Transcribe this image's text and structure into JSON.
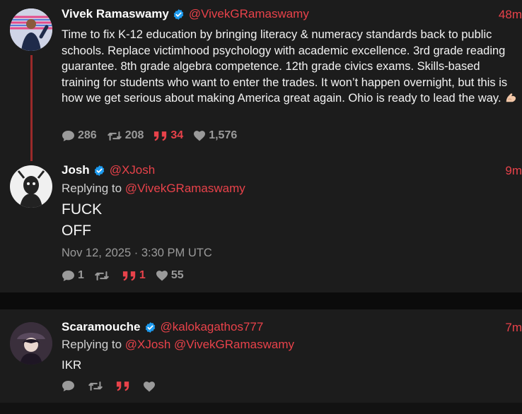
{
  "tweets": [
    {
      "name": "Vivek Ramaswamy",
      "handle": "@VivekGRamaswamy",
      "time": "48m",
      "text": "Time to fix K-12 education by bringing literacy & numeracy standards back to public schools. Replace victimhood psychology with academic excellence. 3rd grade reading guarantee. 8th grade algebra competence. 12th grade civics exams. Skills-based training for students who want to enter the trades. It won’t happen overnight, but this is how we get serious about making America great again. Ohio is ready to lead the way.",
      "emoji": "flexed-biceps",
      "stats": {
        "replies": "286",
        "retweets": "208",
        "quotes": "34",
        "likes": "1,576"
      }
    },
    {
      "name": "Josh",
      "handle": "@XJosh",
      "time": "9m",
      "replying_prefix": "Replying to",
      "replying_to": "@VivekGRamaswamy",
      "line1": "FUCK",
      "line2": "OFF",
      "timestamp": "Nov 12, 2025 · 3:30 PM UTC",
      "stats": {
        "replies": "1",
        "retweets": "",
        "quotes": "1",
        "likes": "55"
      }
    },
    {
      "name": "Scaramouche",
      "handle": "@kalokagathos777",
      "time": "7m",
      "replying_prefix": "Replying to",
      "replying_to": "@XJosh @VivekGRamaswamy",
      "text": "IKR",
      "stats": {
        "replies": "",
        "retweets": "",
        "quotes": "",
        "likes": ""
      }
    }
  ],
  "colors": {
    "accent": "#e8424a",
    "verified": "#1d9bf0",
    "background": "#1c1c1c",
    "muted": "#9a9a9a"
  },
  "icons": [
    "verified-badge-icon",
    "reply-icon",
    "retweet-icon",
    "quote-icon",
    "like-icon"
  ]
}
